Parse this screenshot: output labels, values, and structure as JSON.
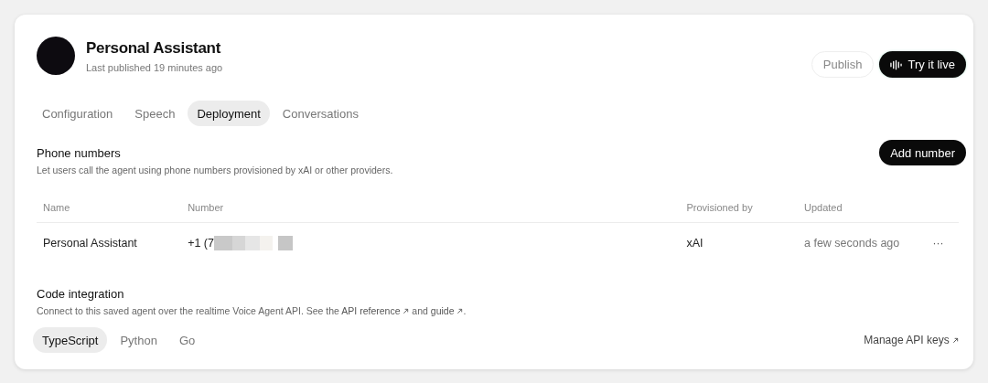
{
  "agent": {
    "name": "Personal Assistant",
    "subtitle": "Last published 19 minutes ago"
  },
  "actions": {
    "publish": "Publish",
    "try_live": "Try it live"
  },
  "tabs": [
    {
      "label": "Configuration",
      "selected": false
    },
    {
      "label": "Speech",
      "selected": false
    },
    {
      "label": "Deployment",
      "selected": true
    },
    {
      "label": "Conversations",
      "selected": false
    }
  ],
  "phone_numbers": {
    "title": "Phone numbers",
    "description": "Let users call the agent using phone numbers provisioned by xAI or other providers.",
    "add_button": "Add number",
    "table": {
      "columns": [
        "Name",
        "Number",
        "Provisioned by",
        "Updated"
      ],
      "rows": [
        {
          "name": "Personal Assistant",
          "number": "+1 (7",
          "provisioned_by": "xAI",
          "updated": "a few seconds ago",
          "menu": "···"
        }
      ]
    }
  },
  "code_integration": {
    "title": "Code integration",
    "description_before": "Connect to this saved agent over the realtime Voice Agent API. See the ",
    "link_1": "API reference",
    "description_middle": " and ",
    "link_2": "guide",
    "description_after": ".",
    "languages": [
      {
        "label": "TypeScript",
        "selected": true
      },
      {
        "label": "Python",
        "selected": false
      },
      {
        "label": "Go",
        "selected": false
      }
    ],
    "manage_keys": "Manage API keys"
  }
}
